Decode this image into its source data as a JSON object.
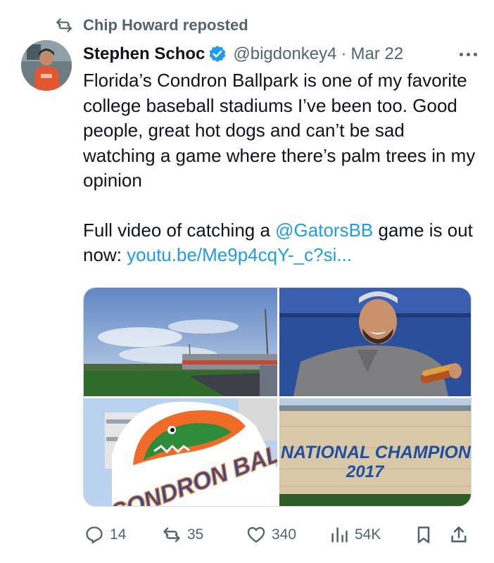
{
  "repost": {
    "icon": "repost-icon",
    "text": "Chip Howard reposted"
  },
  "tweet": {
    "author_name": "Stephen Schoc",
    "verified_icon": "verified-badge-icon",
    "handle": "@bigdonkey4",
    "separator": "·",
    "date": "Mar 22",
    "more_icon": "more-options-icon",
    "paragraph1": "Florida’s Condron Ballpark is one of my favorite college baseball stadiums I’ve been too. Good people, great hot dogs and can’t be sad watching a game where there’s palm trees in my opinion",
    "paragraph2_prefix": "Full video of catching a ",
    "mention": "@GatorsBB",
    "paragraph2_suffix": " game is out now: ",
    "link": "youtu.be/Me9p4cqY-_c?si...",
    "media": {
      "stadium_sign_text": "CONDRON BALLPARK",
      "champions_line1": "NATIONAL CHAMPIONS",
      "champions_line2": "2017"
    }
  },
  "actions": {
    "replies": "14",
    "reposts": "35",
    "likes": "340",
    "views": "54K"
  },
  "colors": {
    "accent": "#1d9bf0",
    "secondary_text": "#536471",
    "primary_text": "#0f1419"
  }
}
